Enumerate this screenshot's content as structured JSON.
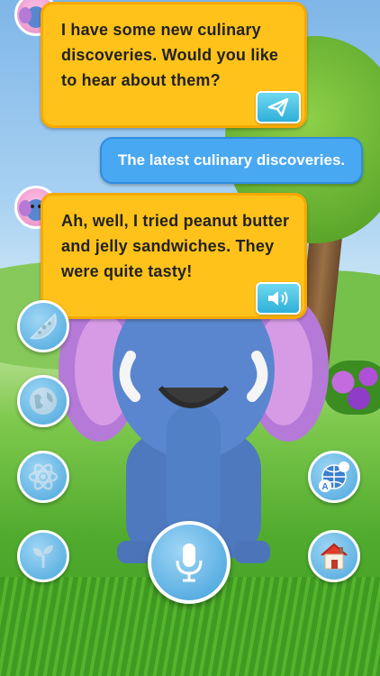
{
  "messages": [
    {
      "role": "bot",
      "text": "I have some new culinary discoveries. Would you like to hear about them?",
      "action_icon": "send-icon"
    },
    {
      "role": "user",
      "text": "The latest culinary discoveries."
    },
    {
      "role": "bot",
      "text": "Ah, well, I tried peanut butter and jelly sandwiches. They were quite tasty!",
      "action_icon": "speaker-icon"
    }
  ],
  "left_buttons": [
    {
      "icon": "pizza-icon"
    },
    {
      "icon": "globe-icon"
    },
    {
      "icon": "atom-icon"
    },
    {
      "icon": "sprout-icon"
    }
  ],
  "right_buttons": [
    {
      "icon": "translate-icon"
    },
    {
      "icon": "home-icon"
    }
  ],
  "mic": {
    "icon": "microphone-icon"
  },
  "colors": {
    "bot_bubble": "#ffc21a",
    "user_bubble": "#49a8f2",
    "button": "#4aa6dc"
  }
}
